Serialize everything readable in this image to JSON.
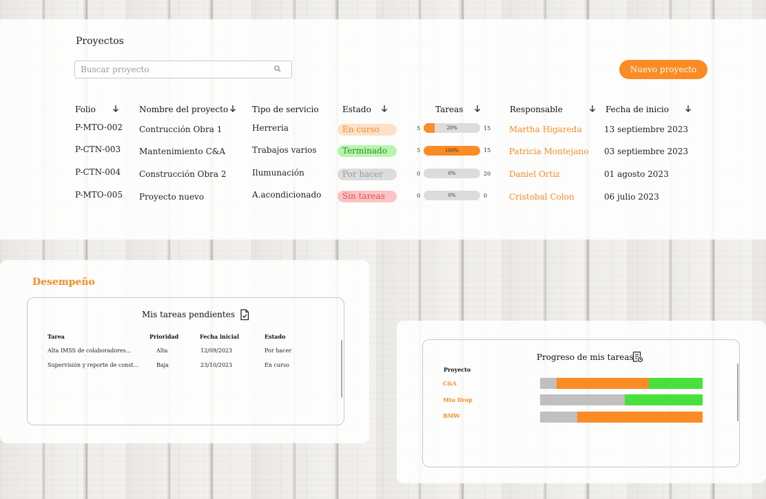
{
  "page": {
    "title": "Proyectos"
  },
  "search": {
    "placeholder": "Buscar proyecto",
    "icon": "search-icon"
  },
  "new_project_button": {
    "label": "Nuevo proyecto",
    "color": "#fb8b24"
  },
  "table": {
    "headers": {
      "folio": "Folio",
      "name": "Nombre del proyecto",
      "type": "Tipo de servicio",
      "status": "Estado",
      "tasks": "Tareas",
      "owner": "Responsable",
      "start": "Fecha de inicio"
    },
    "rows": [
      {
        "folio": "P-MTO-002",
        "name": "Contrucción Obra 1",
        "type": "Herreria",
        "status": "En curso",
        "tasks_done": "5",
        "progress": "20%",
        "progress_value": 0.2,
        "tasks_total": "15",
        "owner": "Martha Higareda",
        "start": "13 septiembre 2023"
      },
      {
        "folio": "P-CTN-003",
        "name": "Mantenimiento C&A",
        "type": "Trabajos varios",
        "status": "Terminado",
        "tasks_done": "5",
        "progress": "100%",
        "progress_value": 1.0,
        "tasks_total": "15",
        "owner": "Patricia Montejano",
        "start": "03 septiembre  2023"
      },
      {
        "folio": "P-CTN-004",
        "name": "Construcción Obra 2",
        "type": "Ilumunación",
        "status": "Por hacer",
        "tasks_done": "0",
        "progress": "0%",
        "progress_value": 0,
        "tasks_total": "20",
        "owner": "Daniel Ortiz",
        "start": "01 agosto  2023"
      },
      {
        "folio": "P-MTO-005",
        "name": "Proyecto nuevo",
        "type": "A.acondicionado",
        "status": "Sin tareas",
        "tasks_done": "0",
        "progress": "0%",
        "progress_value": 0,
        "tasks_total": "0",
        "owner": "Cristobal Colon",
        "start": "06 julio  2023"
      }
    ],
    "status_colors": {
      "En curso": {
        "bg": "#fde0c8",
        "fg": "#fb8b24"
      },
      "Terminado": {
        "bg": "#b6f5ae",
        "fg": "#2f8a2a"
      },
      "Por hacer": {
        "bg": "#dcdcdc",
        "fg": "#9a9a9a"
      },
      "Sin tareas": {
        "bg": "#fbc3c3",
        "fg": "#e05050"
      }
    }
  },
  "performance": {
    "title": "Desempeño",
    "pending": {
      "title": "Mis tareas pendientes",
      "icon": "document-check-icon",
      "headers": {
        "task": "Tarea",
        "priority": "Prioridad",
        "date": "Fecha inicial",
        "status": "Estado"
      },
      "rows": [
        {
          "task": "Alta IMSS de colaboradores...",
          "priority": "Alta",
          "date": "12/09/2023",
          "status": "Por hacer"
        },
        {
          "task": "Supervisión y reporte de const...",
          "priority": "Baja",
          "date": "23/10/2023",
          "status": "En curso"
        }
      ]
    }
  },
  "progress": {
    "title": "Progreso de mis tareas",
    "icon": "task-list-icon",
    "header": "Proyecto",
    "colors": {
      "pending": "#c0c0c0",
      "in_progress": "#fb8b24",
      "done": "#48e03c"
    },
    "rows": [
      {
        "name": "C&A",
        "pending": 0.1,
        "in_progress": 0.57,
        "done": 0.33
      },
      {
        "name": "Mto Drop",
        "pending": 0.52,
        "in_progress": 0.0,
        "done": 0.48
      },
      {
        "name": "BMW",
        "pending": 0.23,
        "in_progress": 0.77,
        "done": 0.0
      }
    ]
  }
}
